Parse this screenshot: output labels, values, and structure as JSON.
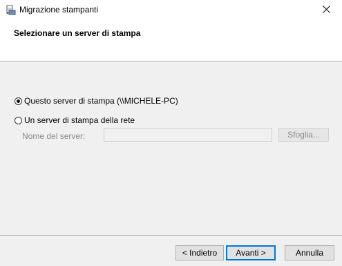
{
  "window": {
    "title": "Migrazione stampanti",
    "close_glyph": "✕"
  },
  "header": {
    "title": "Selezionare un server di stampa"
  },
  "options": {
    "this_server": {
      "label": "Questo server di stampa (\\\\MICHELE-PC)",
      "selected": true
    },
    "network_server": {
      "label": "Un server di stampa della rete",
      "selected": false
    }
  },
  "server_name": {
    "label": "Nome del server:",
    "value": "",
    "enabled": false
  },
  "browse_button": {
    "label": "Sfoglia...",
    "enabled": false
  },
  "buttons": {
    "back": "< Indietro",
    "next": "Avanti >",
    "cancel": "Annulla"
  },
  "colors": {
    "accent": "#0078d7",
    "disabled_text": "#8a8a8a",
    "background": "#f0f0f0"
  }
}
